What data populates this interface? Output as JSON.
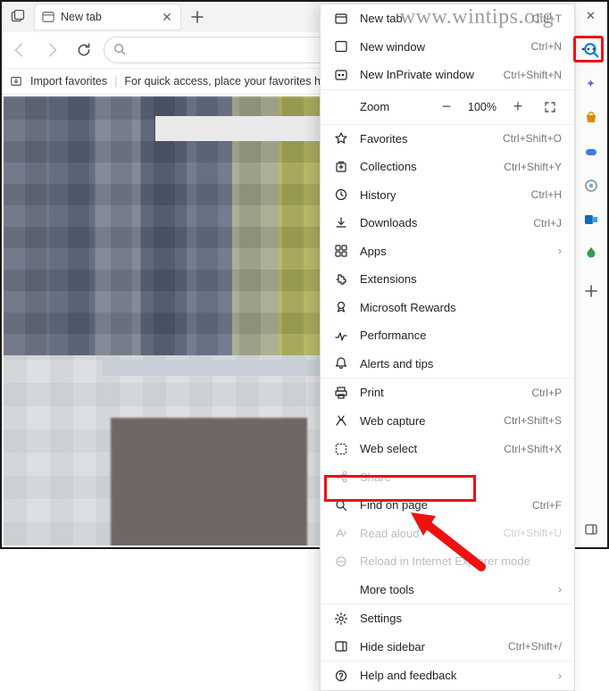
{
  "watermark": "www.wintips.org",
  "tab": {
    "title": "New tab"
  },
  "addressbar": {
    "placeholder": "",
    "value": ""
  },
  "favstrip": {
    "import_label": "Import favorites",
    "hint": "For quick access, place your favorites here on the favorites b"
  },
  "menu": {
    "new_tab": {
      "label": "New tab",
      "shortcut": "Ctrl+T"
    },
    "new_window": {
      "label": "New window",
      "shortcut": "Ctrl+N"
    },
    "new_inprivate": {
      "label": "New InPrivate window",
      "shortcut": "Ctrl+Shift+N"
    },
    "zoom": {
      "label": "Zoom",
      "value": "100%"
    },
    "favorites": {
      "label": "Favorites",
      "shortcut": "Ctrl+Shift+O"
    },
    "collections": {
      "label": "Collections",
      "shortcut": "Ctrl+Shift+Y"
    },
    "history": {
      "label": "History",
      "shortcut": "Ctrl+H"
    },
    "downloads": {
      "label": "Downloads",
      "shortcut": "Ctrl+J"
    },
    "apps": {
      "label": "Apps"
    },
    "extensions": {
      "label": "Extensions"
    },
    "rewards": {
      "label": "Microsoft Rewards"
    },
    "performance": {
      "label": "Performance"
    },
    "alerts": {
      "label": "Alerts and tips"
    },
    "print": {
      "label": "Print",
      "shortcut": "Ctrl+P"
    },
    "webcapture": {
      "label": "Web capture",
      "shortcut": "Ctrl+Shift+S"
    },
    "webselect": {
      "label": "Web select",
      "shortcut": "Ctrl+Shift+X"
    },
    "share": {
      "label": "Share"
    },
    "find": {
      "label": "Find on page",
      "shortcut": "Ctrl+F"
    },
    "readaloud": {
      "label": "Read aloud",
      "shortcut": "Ctrl+Shift+U"
    },
    "iemode": {
      "label": "Reload in Internet Explorer mode"
    },
    "moretools": {
      "label": "More tools"
    },
    "settings": {
      "label": "Settings"
    },
    "hidesidebar": {
      "label": "Hide sidebar",
      "shortcut": "Ctrl+Shift+/"
    },
    "help": {
      "label": "Help and feedback"
    }
  }
}
